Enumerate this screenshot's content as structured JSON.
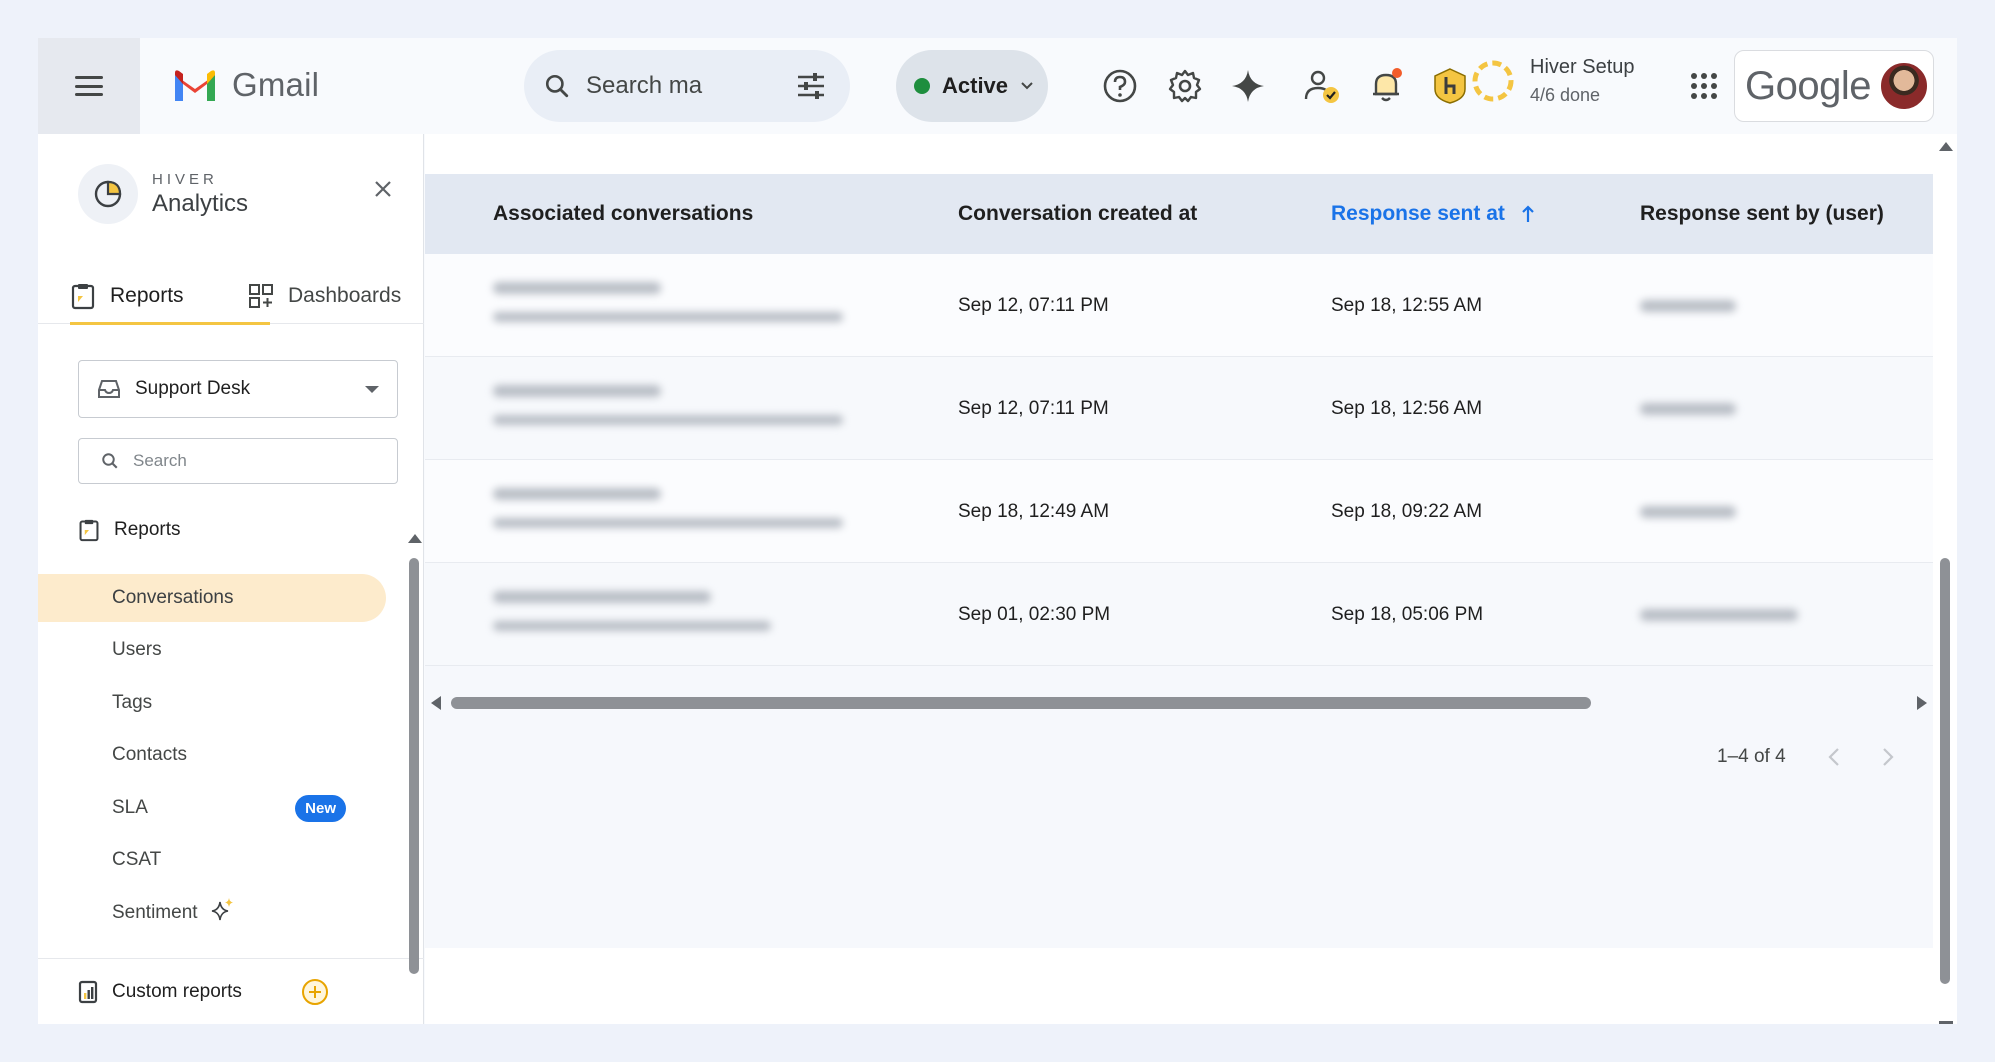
{
  "app": {
    "name": "Gmail"
  },
  "search": {
    "placeholder": "Search ma"
  },
  "status": {
    "label": "Active",
    "color": "#1e8e3e"
  },
  "setup": {
    "title": "Hiver Setup",
    "progress": "4/6 done"
  },
  "account": {
    "brand": "Google"
  },
  "sidebar": {
    "brand_small": "HIVER",
    "brand_big": "Analytics",
    "tabs": [
      {
        "label": "Reports",
        "active": true
      },
      {
        "label": "Dashboards",
        "active": false
      }
    ],
    "inbox": "Support Desk",
    "search_placeholder": "Search",
    "section": "Reports",
    "items": [
      {
        "label": "Conversations",
        "active": true
      },
      {
        "label": "Users"
      },
      {
        "label": "Tags"
      },
      {
        "label": "Contacts"
      },
      {
        "label": "SLA",
        "badge": "New"
      },
      {
        "label": "CSAT"
      },
      {
        "label": "Sentiment",
        "icon": "sparkle-icon"
      }
    ],
    "custom_reports": "Custom reports"
  },
  "table": {
    "columns": [
      "Associated conversations",
      "Conversation created at",
      "Response sent at",
      "Response sent by (user)"
    ],
    "sorted_column": "Response sent at",
    "sort_direction": "ascending",
    "rows": [
      {
        "created": "Sep 12, 07:11 PM",
        "response": "Sep 18, 12:55 AM"
      },
      {
        "created": "Sep 12, 07:11 PM",
        "response": "Sep 18, 12:56 AM"
      },
      {
        "created": "Sep 18, 12:49 AM",
        "response": "Sep 18, 09:22 AM"
      },
      {
        "created": "Sep 01, 02:30 PM",
        "response": "Sep 18, 05:06 PM"
      }
    ],
    "pagination": "1–4 of 4"
  },
  "colors": {
    "accent": "#1a73e8",
    "highlight": "#fdebcc",
    "brand_yellow": "#f4c542"
  }
}
